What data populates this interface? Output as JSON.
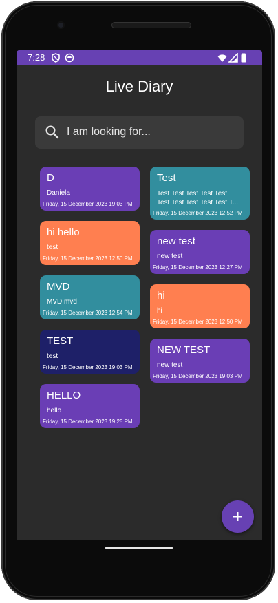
{
  "status": {
    "time": "7:28"
  },
  "app": {
    "title": "Live Diary"
  },
  "search": {
    "placeholder": "I am looking for..."
  },
  "notes_left": [
    {
      "title": "D",
      "body": "Daniela",
      "date": "Friday, 15 December 2023 19:03 PM",
      "color": "#6a3eb5"
    },
    {
      "title": "hi hello",
      "body": "test",
      "date": "Friday, 15 December 2023 12:50 PM",
      "color": "#ff7f50"
    },
    {
      "title": "MVD",
      "body": "MVD mvd",
      "date": "Friday, 15 December 2023 12:54 PM",
      "color": "#328e9e"
    },
    {
      "title": "TEST",
      "body": "test",
      "date": "Friday, 15 December 2023 19:03 PM",
      "color": "#1e2068"
    },
    {
      "title": "HELLO",
      "body": "hello",
      "date": "Friday, 15 December 2023 19:25 PM",
      "color": "#6a3eb5"
    }
  ],
  "notes_right": [
    {
      "title": "Test",
      "body_line1": "Test Test Test Test Test",
      "body_line2": "Test Test Test Test Test T...",
      "date": "Friday, 15 December 2023 12:52 PM",
      "color": "#328e9e"
    },
    {
      "title": "new test",
      "body": "new test",
      "date": "Friday, 15 December 2023 12:27 PM",
      "color": "#6a3eb5"
    },
    {
      "title": "hi",
      "body": "hi",
      "date": "Friday, 15 December 2023 12:50 PM",
      "color": "#ff7f50"
    },
    {
      "title": "NEW TEST",
      "body": "new test",
      "date": "Friday, 15 December 2023 19:03 PM",
      "color": "#6a3eb5"
    }
  ],
  "fab": {
    "icon": "plus-icon"
  },
  "colors": {
    "status_bar": "#6741b3",
    "background": "#2b2b2b",
    "accent": "#6741b3"
  }
}
